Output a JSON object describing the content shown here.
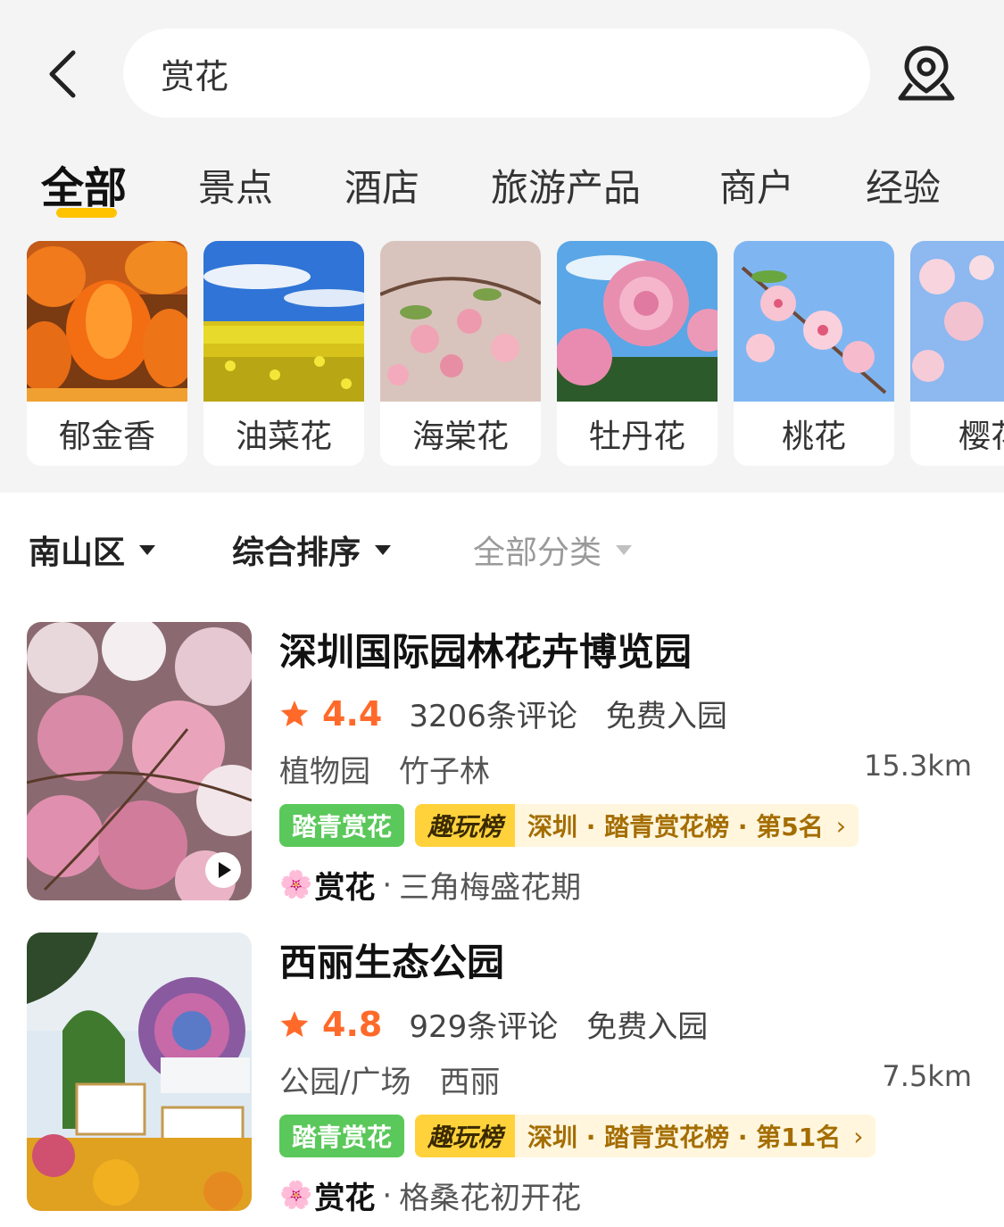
{
  "search": {
    "query": "赏花"
  },
  "tabs": [
    {
      "label": "全部"
    },
    {
      "label": "景点"
    },
    {
      "label": "酒店"
    },
    {
      "label": "旅游产品"
    },
    {
      "label": "商户"
    },
    {
      "label": "经验"
    }
  ],
  "flowers": [
    {
      "label": "郁金香"
    },
    {
      "label": "油菜花"
    },
    {
      "label": "海棠花"
    },
    {
      "label": "牡丹花"
    },
    {
      "label": "桃花"
    },
    {
      "label": "樱花"
    }
  ],
  "filters": {
    "district": "南山区",
    "sort": "综合排序",
    "category": "全部分类"
  },
  "results": [
    {
      "title": "深圳国际园林花卉博览园",
      "score": "4.4",
      "reviews": "3206条评论",
      "ticket": "免费入园",
      "tags": [
        "植物园",
        "竹子林"
      ],
      "distance": "15.3km",
      "badge": "踏青赏花",
      "rank_tag": "趣玩榜",
      "rank_text": "深圳 · 踏青赏花榜 · 第5名",
      "bloom_key": "赏花",
      "bloom_val": "三角梅盛花期"
    },
    {
      "title": "西丽生态公园",
      "score": "4.8",
      "reviews": "929条评论",
      "ticket": "免费入园",
      "tags": [
        "公园/广场",
        "西丽"
      ],
      "distance": "7.5km",
      "badge": "踏青赏花",
      "rank_tag": "趣玩榜",
      "rank_text": "深圳 · 踏青赏花榜 · 第11名",
      "bloom_key": "赏花",
      "bloom_val": "格桑花初开花"
    }
  ],
  "icons": {
    "back": "chevron-left-icon",
    "location": "location-pin-icon",
    "star": "star-icon",
    "play": "play-icon",
    "flower": "flower-icon"
  },
  "colors": {
    "accent_yellow": "#ffc300",
    "score_orange": "#ff6a2a",
    "badge_green": "#5ac85a",
    "rank_text": "#a46d00"
  }
}
